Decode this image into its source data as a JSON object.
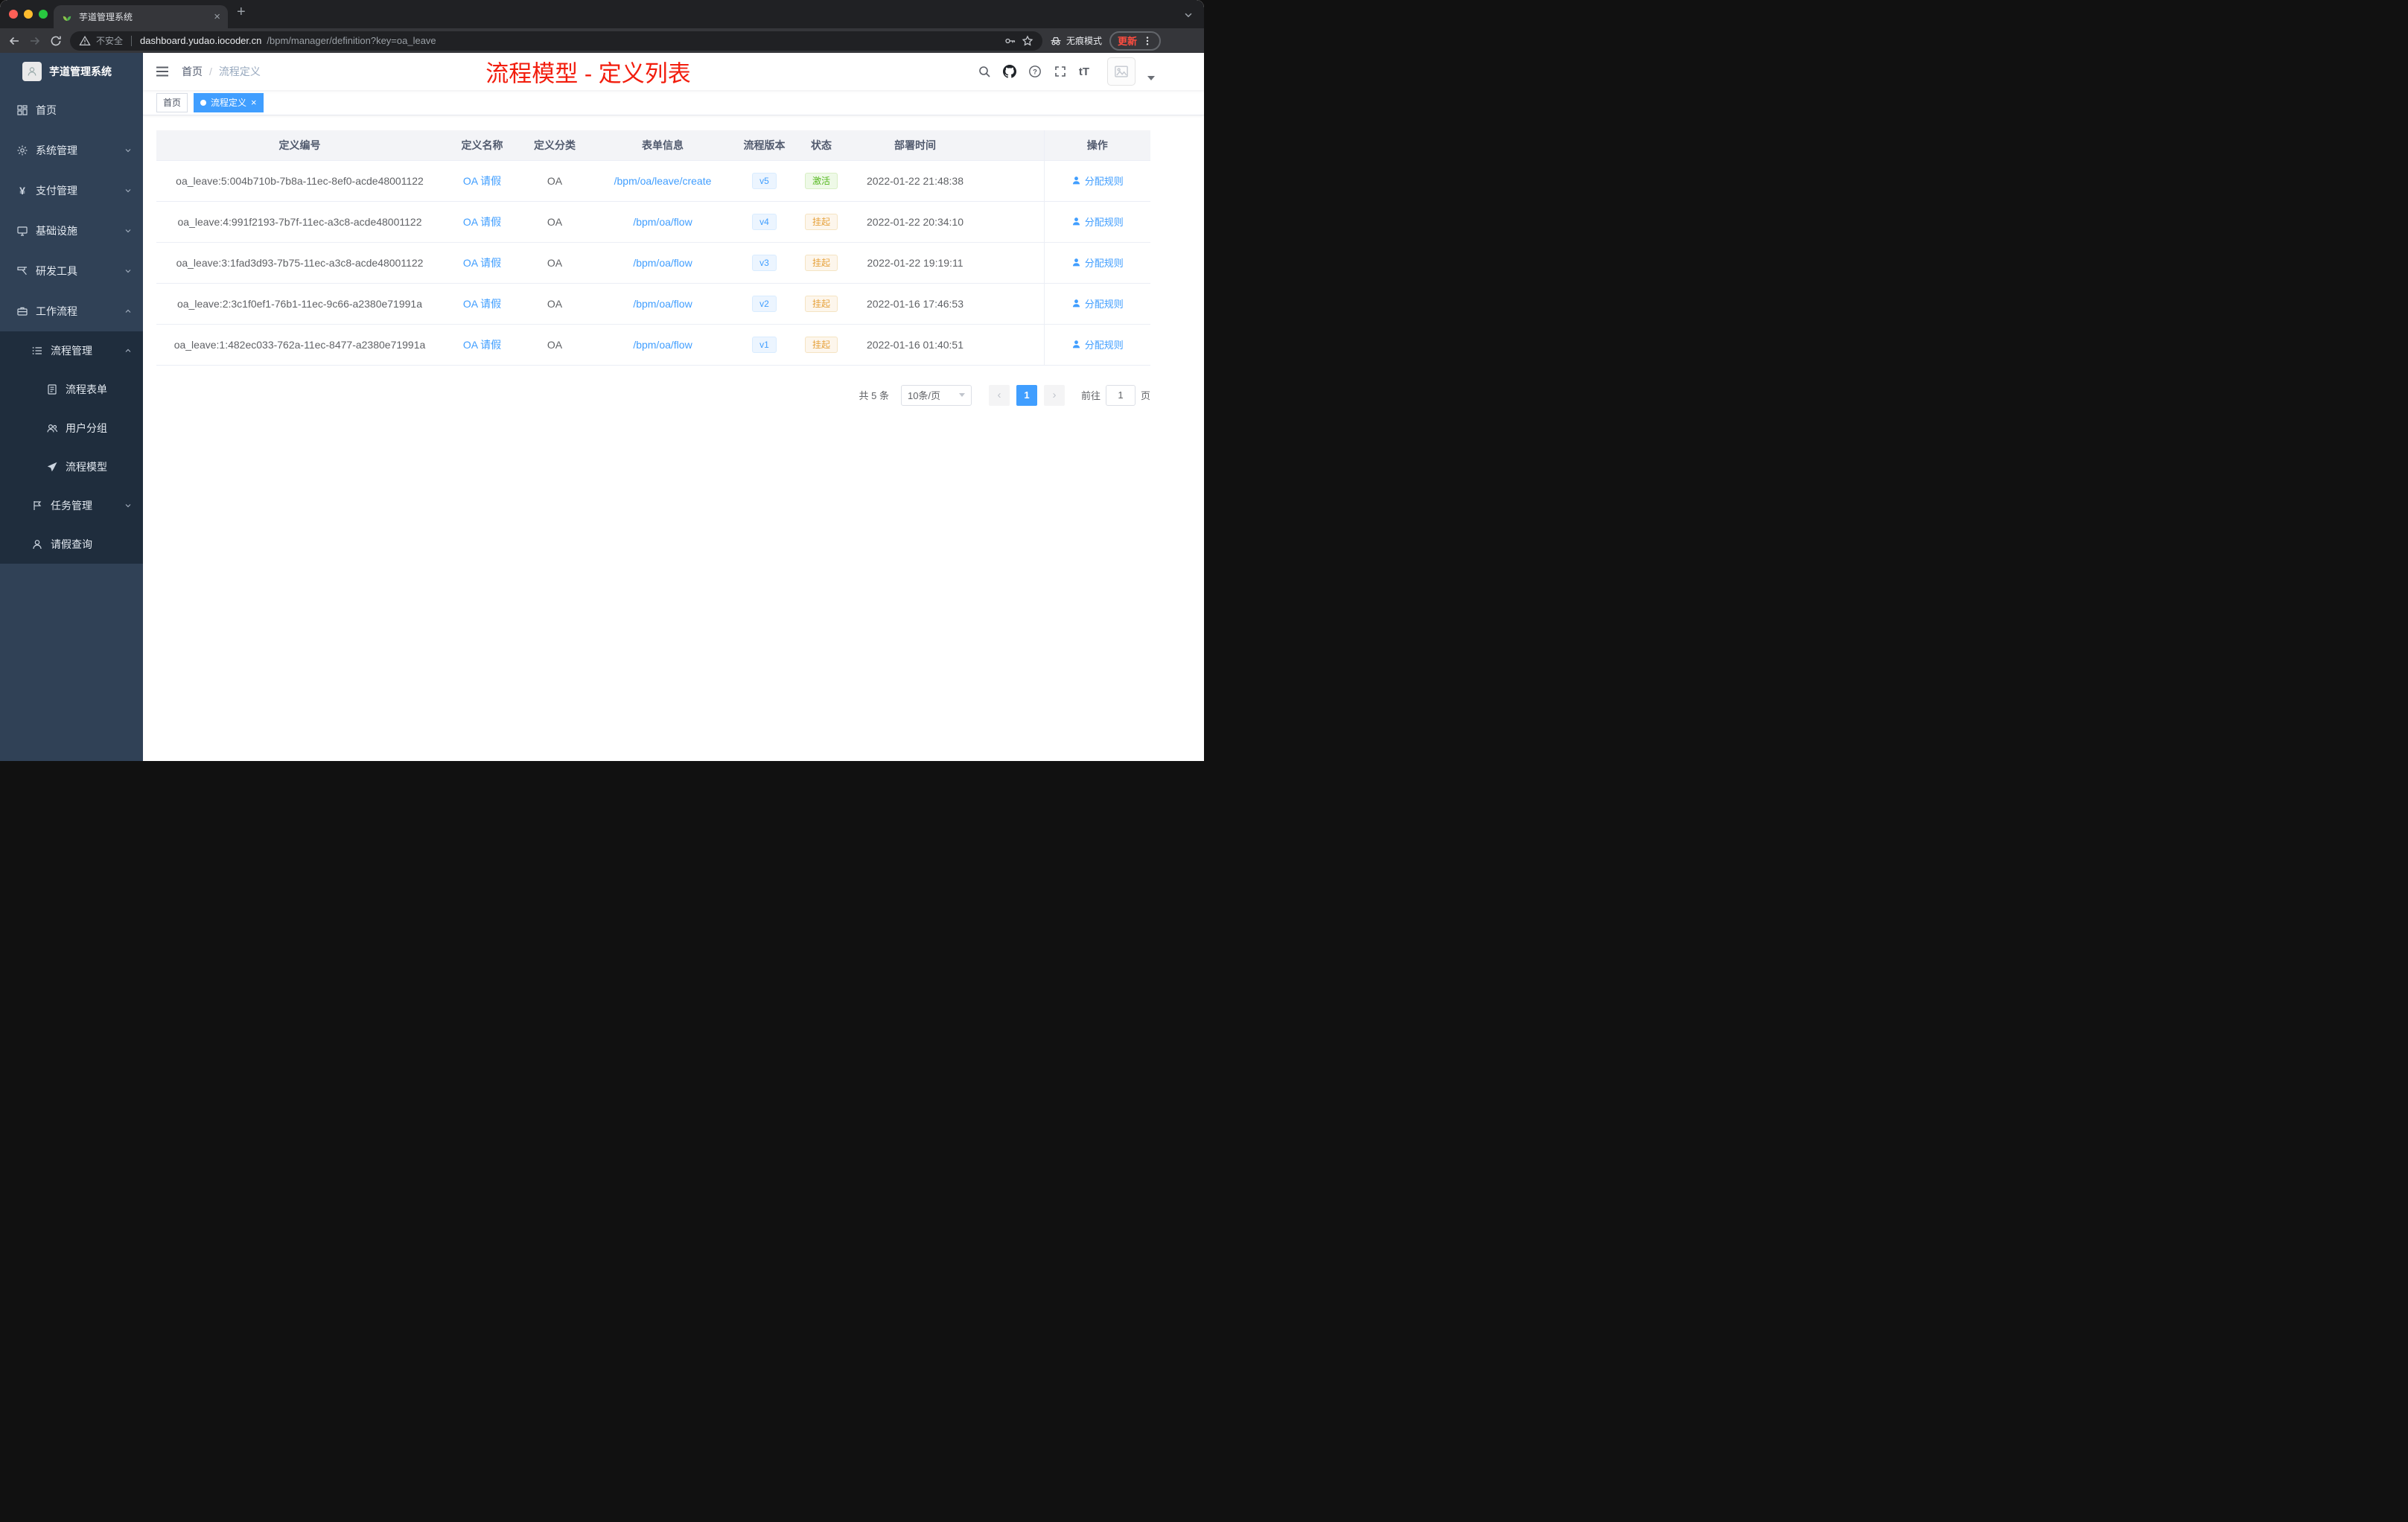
{
  "browser": {
    "tab_title": "芋道管理系统",
    "security_label": "不安全",
    "url_host": "dashboard.yudao.iocoder.cn",
    "url_path": "/bpm/manager/definition?key=oa_leave",
    "incognito_label": "无痕模式",
    "update_label": "更新"
  },
  "sidebar": {
    "logo_title": "芋道管理系统",
    "items": [
      {
        "label": "首页"
      },
      {
        "label": "系统管理"
      },
      {
        "label": "支付管理"
      },
      {
        "label": "基础设施"
      },
      {
        "label": "研发工具"
      },
      {
        "label": "工作流程"
      },
      {
        "label": "流程管理"
      },
      {
        "label": "流程表单"
      },
      {
        "label": "用户分组"
      },
      {
        "label": "流程模型"
      },
      {
        "label": "任务管理"
      },
      {
        "label": "请假查询"
      }
    ]
  },
  "header": {
    "breadcrumb_home": "首页",
    "breadcrumb_sep": "/",
    "breadcrumb_current": "流程定义",
    "annotation": "流程模型 - 定义列表",
    "font_size_label": "tT"
  },
  "tags": {
    "home": "首页",
    "current": "流程定义"
  },
  "table": {
    "columns": [
      "定义编号",
      "定义名称",
      "定义分类",
      "表单信息",
      "流程版本",
      "状态",
      "部署时间",
      "操作"
    ],
    "rows": [
      {
        "id": "oa_leave:5:004b710b-7b8a-11ec-8ef0-acde48001122",
        "name": "OA 请假",
        "category": "OA",
        "form": "/bpm/oa/leave/create",
        "version": "v5",
        "status": "激活",
        "deployed": "2022-01-22 21:48:38",
        "action": "分配规则"
      },
      {
        "id": "oa_leave:4:991f2193-7b7f-11ec-a3c8-acde48001122",
        "name": "OA 请假",
        "category": "OA",
        "form": "/bpm/oa/flow",
        "version": "v4",
        "status": "挂起",
        "deployed": "2022-01-22 20:34:10",
        "action": "分配规则"
      },
      {
        "id": "oa_leave:3:1fad3d93-7b75-11ec-a3c8-acde48001122",
        "name": "OA 请假",
        "category": "OA",
        "form": "/bpm/oa/flow",
        "version": "v3",
        "status": "挂起",
        "deployed": "2022-01-22 19:19:11",
        "action": "分配规则"
      },
      {
        "id": "oa_leave:2:3c1f0ef1-76b1-11ec-9c66-a2380e71991a",
        "name": "OA 请假",
        "category": "OA",
        "form": "/bpm/oa/flow",
        "version": "v2",
        "status": "挂起",
        "deployed": "2022-01-16 17:46:53",
        "action": "分配规则"
      },
      {
        "id": "oa_leave:1:482ec033-762a-11ec-8477-a2380e71991a",
        "name": "OA 请假",
        "category": "OA",
        "form": "/bpm/oa/flow",
        "version": "v1",
        "status": "挂起",
        "deployed": "2022-01-16 01:40:51",
        "action": "分配规则"
      }
    ]
  },
  "pagination": {
    "total": "共 5 条",
    "page_size": "10条/页",
    "page": "1",
    "goto_label": "前往",
    "goto_value": "1",
    "goto_unit": "页"
  },
  "colors": {
    "accent": "#409eff",
    "success": "#55b81f",
    "warning": "#e6a23c",
    "annotation_red": "#f21d0d",
    "sidebar_bg": "#304156",
    "submenu_bg": "#1f2d3d"
  }
}
